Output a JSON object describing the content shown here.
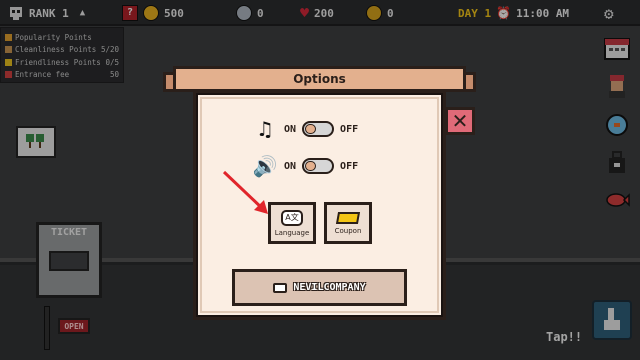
{
  "hud": {
    "rank_label": "RANK 1",
    "gold": "500",
    "silver": "0",
    "hearts": "200",
    "medals": "0",
    "day_label": "DAY 1",
    "time_label": "11:00 AM"
  },
  "stats": [
    {
      "label": "Popularity Points",
      "value": ""
    },
    {
      "label": "Cleanliness Points",
      "value": "5/20"
    },
    {
      "label": "Friendliness Points",
      "value": "0/5"
    },
    {
      "label": "Entrance fee",
      "value": "50"
    }
  ],
  "scene": {
    "ticket_label": "TICKET",
    "open_label": "OPEN",
    "tap_label": "Tap!!"
  },
  "dialog": {
    "title": "Options",
    "music": {
      "on_label": "ON",
      "off_label": "OFF"
    },
    "sound": {
      "on_label": "ON",
      "off_label": "OFF"
    },
    "language_label": "Language",
    "coupon_label": "Coupon",
    "brand_label": "NEVILCOMPANY"
  },
  "colors": {
    "banner": "#e3b08e",
    "dialog_bg": "#fbeee3",
    "close_btn": "#e06a78",
    "arrow": "#e0252b"
  }
}
